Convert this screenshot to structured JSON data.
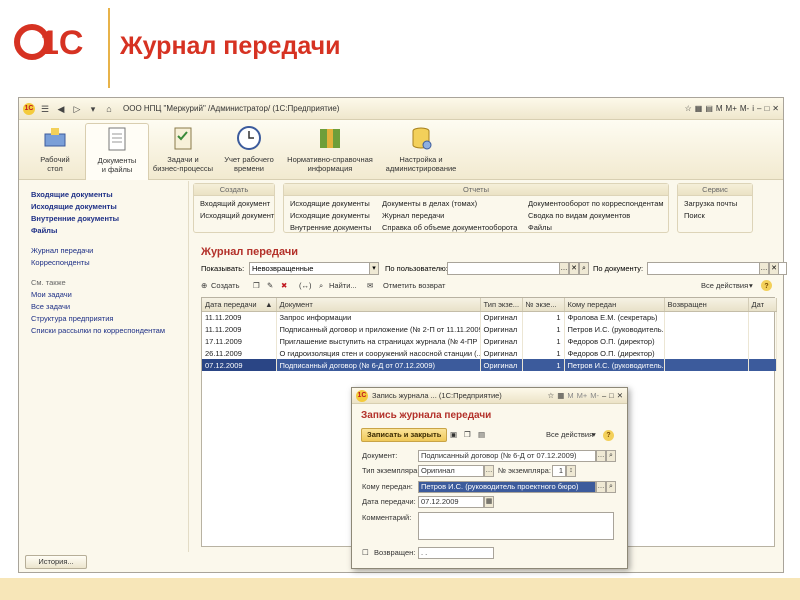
{
  "slide": {
    "logo_text": "1С",
    "title": "Журнал передачи"
  },
  "window": {
    "title": "ООО НПЦ \"Меркурий\" /Администратор/  (1С:Предприятие)",
    "right_controls": [
      "М",
      "М+",
      "М-",
      "i"
    ]
  },
  "sections": [
    {
      "label": "Рабочий\nстол",
      "icon": "desktop-icon"
    },
    {
      "label": "Документы\nи файлы",
      "icon": "documents-icon"
    },
    {
      "label": "Задачи и\nбизнес-процессы",
      "icon": "tasks-icon"
    },
    {
      "label": "Учет рабочего\nвремени",
      "icon": "clock-icon"
    },
    {
      "label": "Нормативно-справочная\nинформация",
      "icon": "books-icon"
    },
    {
      "label": "Настройка и\nадминистрирование",
      "icon": "database-icon"
    }
  ],
  "nav": {
    "main": [
      "Входящие документы",
      "Исходящие документы",
      "Внутренние документы",
      "Файлы"
    ],
    "secondary": [
      "Журнал передачи",
      "Корреспонденты"
    ],
    "see_also_header": "См. также",
    "see_also": [
      "Мои задачи",
      "Все задачи",
      "Структура предприятия",
      "Списки рассылки по корреспондентам"
    ]
  },
  "command_panel": {
    "create": {
      "header": "Создать",
      "items": [
        "Входящий документ",
        "Исходящий документ"
      ]
    },
    "reports": {
      "header": "Отчеты",
      "items": [
        "Исходящие документы",
        "Исходящие документы",
        "Внутренние документы",
        "Документы в делах (томах)",
        "Журнал передачи",
        "Справка об объеме документооборота",
        "Документооборот по корреспондентам",
        "Сводка по видам документов",
        "Файлы"
      ]
    },
    "service": {
      "header": "Сервис",
      "items": [
        "Загрузка почты",
        "Поиск"
      ]
    }
  },
  "journal": {
    "title": "Журнал передачи",
    "show_label": "Показывать:",
    "show_value": "Невозвращенные",
    "by_user_label": "По пользователю:",
    "by_user_value": "",
    "by_doc_label": "По документу:",
    "by_doc_value": "",
    "toolbar": {
      "create": "Создать",
      "find": "Найти...",
      "mark_return": "Отметить возврат",
      "all_actions": "Все действия"
    },
    "columns": [
      "Дата передачи",
      "Документ",
      "Тип экзе...",
      "№ экзе...",
      "Кому передан",
      "Возвращен",
      "Дат"
    ],
    "rows": [
      [
        "11.11.2009",
        "Запрос информации",
        "Оригинал",
        "1",
        "Фролова Е.М. (секретарь)",
        "",
        ""
      ],
      [
        "11.11.2009",
        "Подписанный договор и приложение (№ 2-П от 11.11.2009)",
        "Оригинал",
        "1",
        "Петров И.С. (руководитель...",
        "",
        ""
      ],
      [
        "17.11.2009",
        "Приглашение выступить на страницах журнала (№ 4-ПР ...",
        "Оригинал",
        "1",
        "Федоров О.П. (директор)",
        "",
        ""
      ],
      [
        "26.11.2009",
        "О гидроизоляция стен и сооружений насосной станции (...",
        "Оригинал",
        "1",
        "Федоров О.П. (директор)",
        "",
        ""
      ],
      [
        "07.12.2009",
        "Подписанный договор (№ 6-Д от 07.12.2009)",
        "Оригинал",
        "1",
        "Петров И.С. (руководитель...",
        "",
        ""
      ]
    ],
    "selected_row": 4
  },
  "history_button": "История...",
  "dialog": {
    "window_title": "Запись журнала ...  (1С:Предприятие)",
    "title": "Запись журнала передачи",
    "save_close": "Записать и закрыть",
    "all_actions": "Все действия",
    "document_label": "Документ:",
    "document_value": "Подписанный договор (№ 6-Д от 07.12.2009)",
    "copy_type_label": "Тип экземпляра:",
    "copy_type_value": "Оригинал",
    "copy_num_label": "№ экземпляра:",
    "copy_num_value": "1",
    "to_label": "Кому передан:",
    "to_value": "Петров И.С. (руководитель проектного бюро)",
    "date_label": "Дата передачи:",
    "date_value": "07.12.2009",
    "comment_label": "Комментарий:",
    "returned_label": "Возвращен:",
    "returned_value": ". ."
  }
}
